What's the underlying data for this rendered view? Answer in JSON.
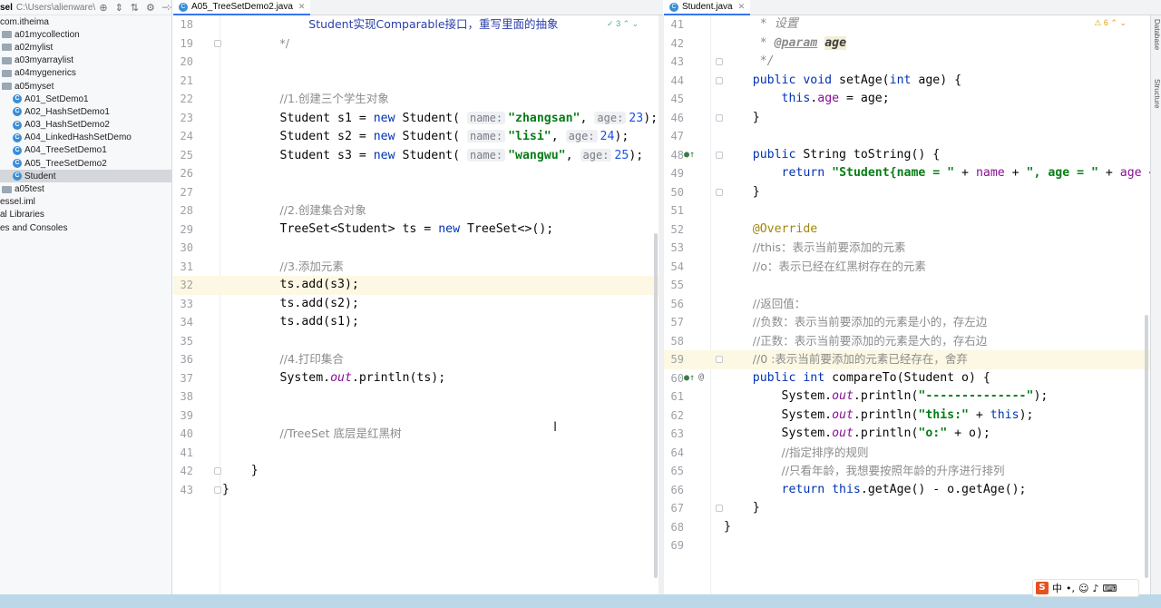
{
  "project": {
    "name": "sel",
    "path": "C:\\Users\\alienware\\IdeaProjects\\basic-cod",
    "items": [
      {
        "label": "com.itheima",
        "type": "package",
        "indent": 0
      },
      {
        "label": "a01mycollection",
        "type": "folder",
        "indent": 1
      },
      {
        "label": "a02mylist",
        "type": "folder",
        "indent": 1
      },
      {
        "label": "a03myarraylist",
        "type": "folder",
        "indent": 1
      },
      {
        "label": "a04mygenerics",
        "type": "folder",
        "indent": 1
      },
      {
        "label": "a05myset",
        "type": "folder",
        "indent": 1
      },
      {
        "label": "A01_SetDemo1",
        "type": "class",
        "indent": 2
      },
      {
        "label": "A02_HashSetDemo1",
        "type": "class",
        "indent": 2
      },
      {
        "label": "A03_HashSetDemo2",
        "type": "class",
        "indent": 2
      },
      {
        "label": "A04_LinkedHashSetDemo",
        "type": "class",
        "indent": 2
      },
      {
        "label": "A04_TreeSetDemo1",
        "type": "class",
        "indent": 2
      },
      {
        "label": "A05_TreeSetDemo2",
        "type": "class",
        "indent": 2
      },
      {
        "label": "Student",
        "type": "class",
        "indent": 2,
        "selected": true
      },
      {
        "label": "a05test",
        "type": "folder",
        "indent": 1
      },
      {
        "label": "essel.iml",
        "type": "file",
        "indent": 0
      },
      {
        "label": "al Libraries",
        "type": "file",
        "indent": 0
      },
      {
        "label": "es and Consoles",
        "type": "file",
        "indent": 0
      }
    ]
  },
  "tabs": {
    "left": {
      "label": "A05_TreeSetDemo2.java",
      "icon": "class-icon"
    },
    "right": {
      "label": "Student.java",
      "icon": "class-icon"
    }
  },
  "left_editor": {
    "warning_count": "3",
    "lines": [
      {
        "n": "18",
        "html": "            <span class='cm-blue'>Student实现Comparable接口，重写里面的抽象</span>"
      },
      {
        "n": "19",
        "html": "        <span class='cm'>*/</span>"
      },
      {
        "n": "20",
        "html": ""
      },
      {
        "n": "21",
        "html": ""
      },
      {
        "n": "22",
        "html": "        <span class='cm'>//1.创建三个学生对象</span>"
      },
      {
        "n": "23",
        "html": "        Student s1 = <span class='kw'>new</span> Student( <span class='hint'>name:</span><span class='str'>\"zhangsan\"</span>, <span class='hint'>age:</span><span class='num'>23</span>);"
      },
      {
        "n": "24",
        "html": "        Student s2 = <span class='kw'>new</span> Student( <span class='hint'>name:</span><span class='str'>\"lisi\"</span>, <span class='hint'>age:</span><span class='num'>24</span>);"
      },
      {
        "n": "25",
        "html": "        Student s3 = <span class='kw'>new</span> Student( <span class='hint'>name:</span><span class='str'>\"wangwu\"</span>, <span class='hint'>age:</span><span class='num'>25</span>);"
      },
      {
        "n": "26",
        "html": ""
      },
      {
        "n": "27",
        "html": ""
      },
      {
        "n": "28",
        "html": "        <span class='cm'>//2.创建集合对象</span>"
      },
      {
        "n": "29",
        "html": "        TreeSet&lt;Student&gt; ts = <span class='kw'>new</span> TreeSet&lt;&gt;();"
      },
      {
        "n": "30",
        "html": ""
      },
      {
        "n": "31",
        "html": "        <span class='cm'>//3.添加元素</span>"
      },
      {
        "n": "32",
        "html": "        ts.add(s3);",
        "hl": true
      },
      {
        "n": "33",
        "html": "        ts.add(s2);"
      },
      {
        "n": "34",
        "html": "        ts.add(s1);"
      },
      {
        "n": "35",
        "html": ""
      },
      {
        "n": "36",
        "html": "        <span class='cm'>//4.打印集合</span>"
      },
      {
        "n": "37",
        "html": "        System.<span class='ital'>out</span>.println(ts);"
      },
      {
        "n": "38",
        "html": ""
      },
      {
        "n": "39",
        "html": ""
      },
      {
        "n": "40",
        "html": "        <span class='cm'>//TreeSet 底层是红黑树</span>"
      },
      {
        "n": "41",
        "html": ""
      },
      {
        "n": "42",
        "html": "    }"
      },
      {
        "n": "43",
        "html": "}"
      }
    ]
  },
  "right_editor": {
    "warning_count": "6",
    "lines": [
      {
        "n": "41",
        "html": "     <span class='doc'>* 设置</span>"
      },
      {
        "n": "42",
        "html": "     <span class='doc'>* </span><span class='doctag'>@param</span> <span class='docparam'>age</span>"
      },
      {
        "n": "43",
        "html": "     <span class='doc'>*/</span>"
      },
      {
        "n": "44",
        "html": "    <span class='kw'>public void</span> setAge(<span class='kw'>int</span> age) {"
      },
      {
        "n": "45",
        "html": "        <span class='kw'>this</span>.<span class='fld'>age</span> = age;"
      },
      {
        "n": "46",
        "html": "    }"
      },
      {
        "n": "47",
        "html": ""
      },
      {
        "n": "48",
        "html": "    <span class='kw'>public</span> String toString() {"
      },
      {
        "n": "49",
        "html": "        <span class='kw'>return</span> <span class='str'>\"Student{name = \"</span> + <span class='fld'>name</span> + <span class='str'>\", age = \"</span> + <span class='fld'>age</span> +"
      },
      {
        "n": "50",
        "html": "    }"
      },
      {
        "n": "51",
        "html": ""
      },
      {
        "n": "52",
        "html": "    <span class='ann'>@Override</span>"
      },
      {
        "n": "53",
        "html": "    <span class='cm'>//this：表示当前要添加的元素</span>"
      },
      {
        "n": "54",
        "html": "    <span class='cm'>//o：表示已经在红黑树存在的元素</span>"
      },
      {
        "n": "55",
        "html": ""
      },
      {
        "n": "56",
        "html": "    <span class='cm'>//返回值：</span>"
      },
      {
        "n": "57",
        "html": "    <span class='cm'>//负数：表示当前要添加的元素是小的，存左边</span>"
      },
      {
        "n": "58",
        "html": "    <span class='cm'>//正数：表示当前要添加的元素是大的，存右边</span>"
      },
      {
        "n": "59",
        "html": "    <span class='cm'>//0 :表示当前要添加的元素已经存在，舍弃</span>",
        "hl": true
      },
      {
        "n": "60",
        "html": "    <span class='kw'>public int</span> compareTo(Student o) {"
      },
      {
        "n": "61",
        "html": "        System.<span class='ital'>out</span>.println(<span class='str'>\"--------------\"</span>);"
      },
      {
        "n": "62",
        "html": "        System.<span class='ital'>out</span>.println(<span class='str'>\"this:\"</span> + <span class='kw'>this</span>);"
      },
      {
        "n": "63",
        "html": "        System.<span class='ital'>out</span>.println(<span class='str'>\"o:\"</span> + o);"
      },
      {
        "n": "64",
        "html": "        <span class='cm'>//指定排序的规则</span>"
      },
      {
        "n": "65",
        "html": "        <span class='cm'>//只看年龄，我想要按照年龄的升序进行排列</span>"
      },
      {
        "n": "66",
        "html": "        <span class='kw'>return this</span>.getAge() - o.getAge();"
      },
      {
        "n": "67",
        "html": "    }"
      },
      {
        "n": "68",
        "html": "}"
      },
      {
        "n": "69",
        "html": ""
      }
    ]
  },
  "side_panels": [
    "Database",
    "Structure"
  ],
  "ime": {
    "lang": "中"
  }
}
